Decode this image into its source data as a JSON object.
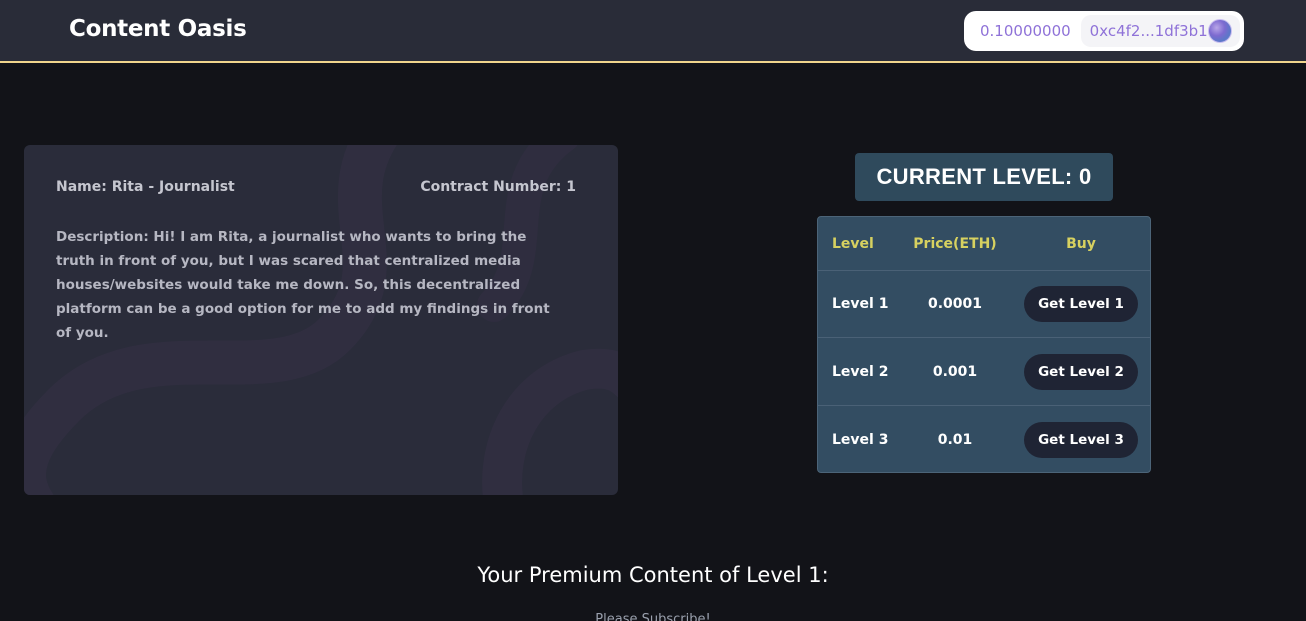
{
  "header": {
    "brand": "Content Oasis",
    "wallet_balance": "0.10000000",
    "wallet_address": "0xc4f2...1df3b1"
  },
  "profile": {
    "name": "Name: Rita - Journalist",
    "contract": "Contract Number: 1",
    "description": "Description: Hi! I am Rita, a journalist who wants to bring the truth in front of you, but I was scared that centralized media houses/websites would take me down. So, this decentralized platform can be a good option for me to add my findings in front of you."
  },
  "level_panel": {
    "current_level": "CURRENT LEVEL: 0",
    "headers": [
      "Level",
      "Price(ETH)",
      "Buy"
    ],
    "rows": [
      {
        "level": "Level 1",
        "price": "0.0001",
        "button": "Get Level 1"
      },
      {
        "level": "Level 2",
        "price": "0.001",
        "button": "Get Level 2"
      },
      {
        "level": "Level 3",
        "price": "0.01",
        "button": "Get Level 3"
      }
    ]
  },
  "premium": {
    "title": "Your Premium Content of Level 1:",
    "note": "Please Subscribe!"
  },
  "colors": {
    "navbar": "#292c38",
    "accent_border": "#f0d58c",
    "wallet_text": "#8f72d8",
    "card_bg": "#2a2c3a",
    "table_bg": "#334d62",
    "table_header_text": "#d7d160",
    "button_bg": "#1f2434"
  }
}
